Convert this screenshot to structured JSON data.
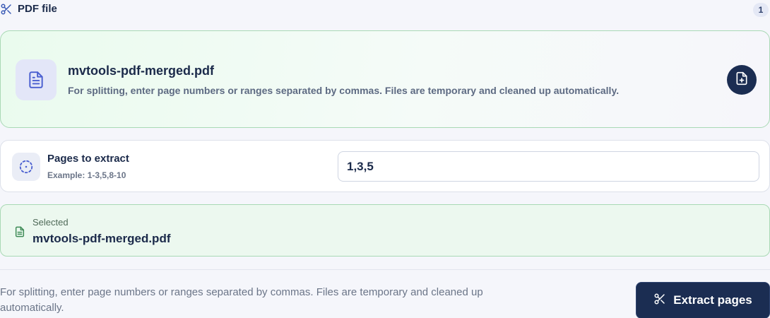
{
  "header": {
    "title": "PDF file",
    "count": "1",
    "icon": "scissors-icon"
  },
  "file_card": {
    "file_name": "mvtools-pdf-merged.pdf",
    "description": "For splitting, enter page numbers or ranges separated by commas. Files are temporary and cleaned up automatically.",
    "icon": "file-text-icon",
    "action_icon": "file-plus-icon"
  },
  "pages": {
    "label": "Pages to extract",
    "hint": "Example: 1-3,5,8-10",
    "value": "1,3,5",
    "icon": "dotted-circle-icon"
  },
  "selected": {
    "label": "Selected",
    "file_name": "mvtools-pdf-merged.pdf",
    "icon": "file-text-icon"
  },
  "footer": {
    "note": "For splitting, enter page numbers or ranges separated by commas. Files are temporary and cleaned up automatically.",
    "extract_label": "Extract pages",
    "extract_icon": "scissors-icon"
  },
  "colors": {
    "primary": "#1b2d52",
    "accent_green_border": "#a9d9b5",
    "accent_green_bg": "#ecf8ef",
    "icon_blue": "#4a5fd0",
    "icon_green": "#3d8a55"
  }
}
